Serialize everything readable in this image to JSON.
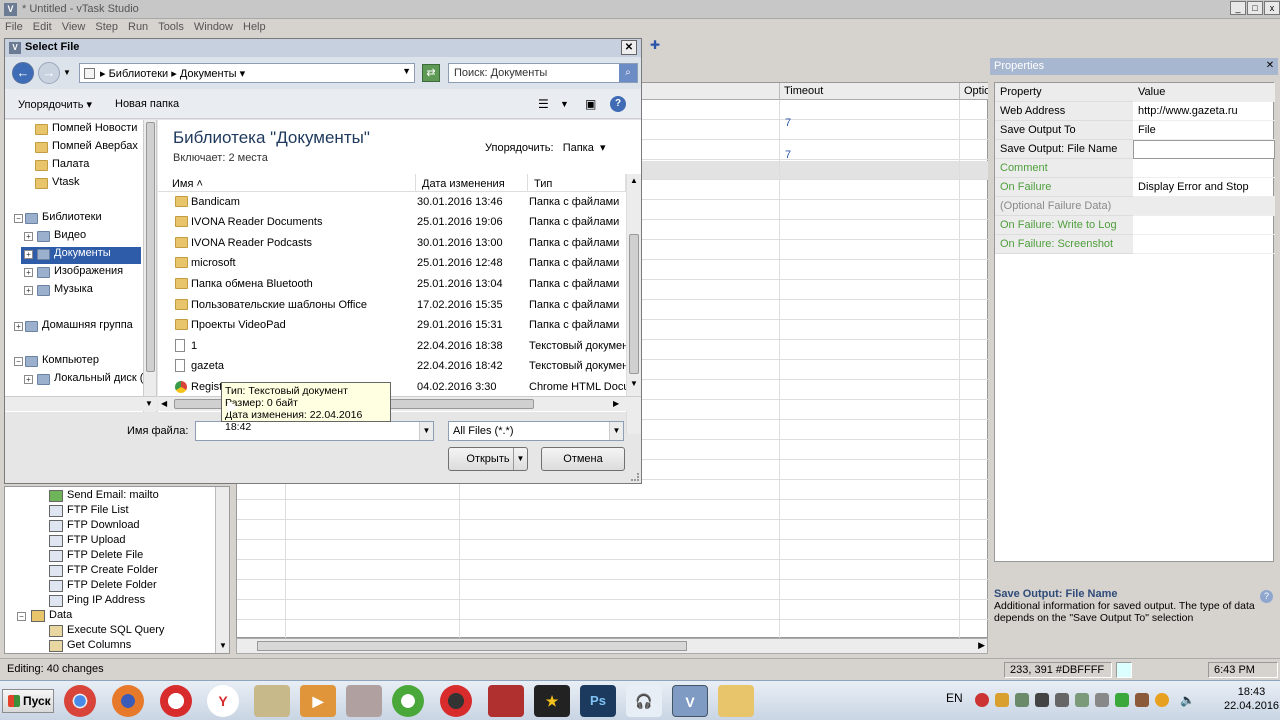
{
  "app": {
    "title": "* Untitled - vTask Studio",
    "menu": [
      "File",
      "Edit",
      "View",
      "Step",
      "Run",
      "Tools",
      "Window",
      "Help"
    ]
  },
  "grid": {
    "columns": [
      "Timeout",
      "Optio"
    ],
    "timeout_values": [
      "7",
      "7"
    ]
  },
  "properties": {
    "title": "Properties",
    "headers": {
      "property": "Property",
      "value": "Value"
    },
    "rows": [
      {
        "name": "Web Address",
        "value": "http://www.gazeta.ru",
        "style": "normal"
      },
      {
        "name": "Save Output To",
        "value": "File",
        "style": "normal"
      },
      {
        "name": "Save Output: File Name",
        "value": "",
        "style": "normal"
      },
      {
        "name": "Comment",
        "value": "",
        "style": "green"
      },
      {
        "name": "On Failure",
        "value": "Display Error and Stop",
        "style": "green"
      },
      {
        "name": "(Optional Failure Data)",
        "value": "",
        "style": "gray"
      },
      {
        "name": "On Failure: Write to Log",
        "value": "",
        "style": "green"
      },
      {
        "name": "On Failure: Screenshot",
        "value": "",
        "style": "green"
      }
    ],
    "desc_title": "Save Output: File Name",
    "desc_text": "Additional information for saved output.  The type of data depends on the \"Save Output To\" selection"
  },
  "tree": {
    "items": [
      "Send Email: mailto",
      "FTP File List",
      "FTP Download",
      "FTP Upload",
      "FTP Delete File",
      "FTP Create Folder",
      "FTP Delete Folder",
      "Ping IP Address",
      "Data",
      "Execute SQL Query",
      "Get Columns"
    ]
  },
  "status": {
    "left": "Editing: 40 changes",
    "coords": "233, 391  #DBFFFF",
    "time": "6:43 PM"
  },
  "taskbar": {
    "start": "Пуск",
    "lang": "EN",
    "clock_time": "18:43",
    "clock_date": "22.04.2016"
  },
  "dialog": {
    "title": "Select File",
    "breadcrumb": [
      "Библиотеки",
      "Документы"
    ],
    "search_placeholder": "Поиск: Документы",
    "organize": "Упорядочить",
    "new_folder": "Новая папка",
    "nav_items": [
      {
        "label": "Помпей Новости",
        "kind": "folder"
      },
      {
        "label": "Помпей Авербах",
        "kind": "folder"
      },
      {
        "label": "Палата",
        "kind": "folder"
      },
      {
        "label": "Vtask",
        "kind": "folder"
      },
      {
        "label": "Библиотеки",
        "kind": "lib"
      },
      {
        "label": "Видео",
        "kind": "lib"
      },
      {
        "label": "Документы",
        "kind": "lib"
      },
      {
        "label": "Изображения",
        "kind": "lib"
      },
      {
        "label": "Музыка",
        "kind": "lib"
      },
      {
        "label": "Домашняя группа",
        "kind": "lib"
      },
      {
        "label": "Компьютер",
        "kind": "lib"
      },
      {
        "label": "Локальный диск (",
        "kind": "lib"
      }
    ],
    "library_title": "Библиотека \"Документы\"",
    "library_sub": "Включает:  2 места",
    "arrange_label": "Упорядочить:",
    "arrange_value": "Папка",
    "columns": {
      "name": "Имя",
      "date": "Дата изменения",
      "type": "Тип"
    },
    "files": [
      {
        "name": "Bandicam",
        "date": "30.01.2016 13:46",
        "type": "Папка с файлами",
        "icon": "folder"
      },
      {
        "name": "IVONA Reader Documents",
        "date": "25.01.2016 19:06",
        "type": "Папка с файлами",
        "icon": "folder"
      },
      {
        "name": "IVONA Reader Podcasts",
        "date": "30.01.2016 13:00",
        "type": "Папка с файлами",
        "icon": "folder"
      },
      {
        "name": "microsoft",
        "date": "25.01.2016 12:48",
        "type": "Папка с файлами",
        "icon": "folder"
      },
      {
        "name": "Папка обмена Bluetooth",
        "date": "25.01.2016 13:04",
        "type": "Папка с файлами",
        "icon": "folder"
      },
      {
        "name": "Пользовательские шаблоны Office",
        "date": "17.02.2016 15:35",
        "type": "Папка с файлами",
        "icon": "folder"
      },
      {
        "name": "Проекты VideoPad",
        "date": "29.01.2016 15:31",
        "type": "Папка с файлами",
        "icon": "folder"
      },
      {
        "name": "1",
        "date": "22.04.2016 18:38",
        "type": "Текстовый документ",
        "icon": "text"
      },
      {
        "name": "gazeta",
        "date": "22.04.2016 18:42",
        "type": "Текстовый документ",
        "icon": "text"
      },
      {
        "name": "Regist",
        "date": "04.02.2016 3:30",
        "type": "Chrome HTML Docu...",
        "icon": "chrome"
      }
    ],
    "tooltip": {
      "line1": "Тип: Текстовый документ",
      "line2": "Размер: 0 байт",
      "line3": "Дата изменения: 22.04.2016 18:42"
    },
    "filename_label": "Имя файла:",
    "filename_value": "",
    "filter_value": "All Files (*.*)",
    "open_label": "Открыть",
    "cancel_label": "Отмена"
  }
}
